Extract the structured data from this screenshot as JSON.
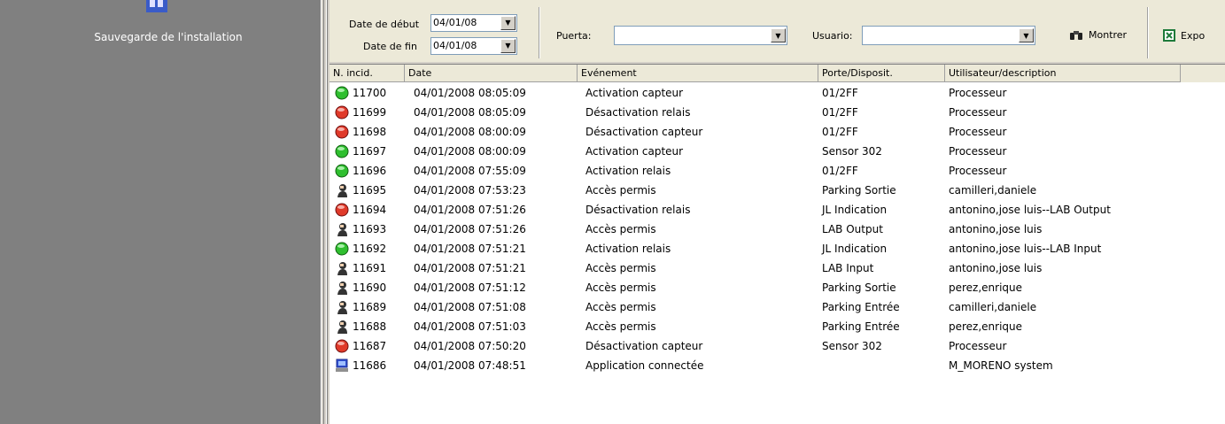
{
  "sidebar": {
    "label": "Sauvegarde de l'installation",
    "icon": "backup-icon"
  },
  "toolbar": {
    "date_start_label": "Date de début",
    "date_start_value": "04/01/08",
    "date_end_label": "Date de fin",
    "date_end_value": "04/01/08",
    "door_label": "Puerta:",
    "door_value": "",
    "user_label": "Usuario:",
    "user_value": "",
    "show_label": "Montrer",
    "export_label": "Expo"
  },
  "table": {
    "columns": [
      "N. incid.",
      "Date",
      "Evénement",
      "Porte/Disposit.",
      "Utilisateur/description"
    ],
    "rows": [
      {
        "status": "green",
        "id": "11700",
        "date": "04/01/2008 08:05:09",
        "event": "Activation capteur",
        "door": "01/2FF",
        "user": "Processeur"
      },
      {
        "status": "red",
        "id": "11699",
        "date": "04/01/2008 08:05:09",
        "event": "Désactivation relais",
        "door": "01/2FF",
        "user": "Processeur"
      },
      {
        "status": "red",
        "id": "11698",
        "date": "04/01/2008 08:00:09",
        "event": "Désactivation capteur",
        "door": "01/2FF",
        "user": "Processeur"
      },
      {
        "status": "green",
        "id": "11697",
        "date": "04/01/2008 08:00:09",
        "event": "Activation capteur",
        "door": "Sensor 302",
        "user": "Processeur"
      },
      {
        "status": "green",
        "id": "11696",
        "date": "04/01/2008 07:55:09",
        "event": "Activation relais",
        "door": "01/2FF",
        "user": "Processeur"
      },
      {
        "status": "person",
        "id": "11695",
        "date": "04/01/2008 07:53:23",
        "event": "Accès permis",
        "door": "Parking Sortie",
        "user": "camilleri,daniele"
      },
      {
        "status": "red",
        "id": "11694",
        "date": "04/01/2008 07:51:26",
        "event": "Désactivation relais",
        "door": "JL Indication",
        "user": "antonino,jose luis--LAB Output"
      },
      {
        "status": "person",
        "id": "11693",
        "date": "04/01/2008 07:51:26",
        "event": "Accès permis",
        "door": "LAB Output",
        "user": "antonino,jose luis"
      },
      {
        "status": "green",
        "id": "11692",
        "date": "04/01/2008 07:51:21",
        "event": "Activation relais",
        "door": "JL Indication",
        "user": "antonino,jose luis--LAB Input"
      },
      {
        "status": "person",
        "id": "11691",
        "date": "04/01/2008 07:51:21",
        "event": "Accès permis",
        "door": "LAB Input",
        "user": "antonino,jose luis"
      },
      {
        "status": "person",
        "id": "11690",
        "date": "04/01/2008 07:51:12",
        "event": "Accès permis",
        "door": "Parking Sortie",
        "user": "perez,enrique"
      },
      {
        "status": "person",
        "id": "11689",
        "date": "04/01/2008 07:51:08",
        "event": "Accès permis",
        "door": "Parking Entrée",
        "user": "camilleri,daniele"
      },
      {
        "status": "person",
        "id": "11688",
        "date": "04/01/2008 07:51:03",
        "event": "Accès permis",
        "door": "Parking Entrée",
        "user": "perez,enrique"
      },
      {
        "status": "red",
        "id": "11687",
        "date": "04/01/2008 07:50:20",
        "event": "Désactivation capteur",
        "door": "Sensor 302",
        "user": "Processeur"
      },
      {
        "status": "computer",
        "id": "11686",
        "date": "04/01/2008 07:48:51",
        "event": "Application connectée",
        "door": "",
        "user": "M_MORENO system"
      }
    ]
  }
}
